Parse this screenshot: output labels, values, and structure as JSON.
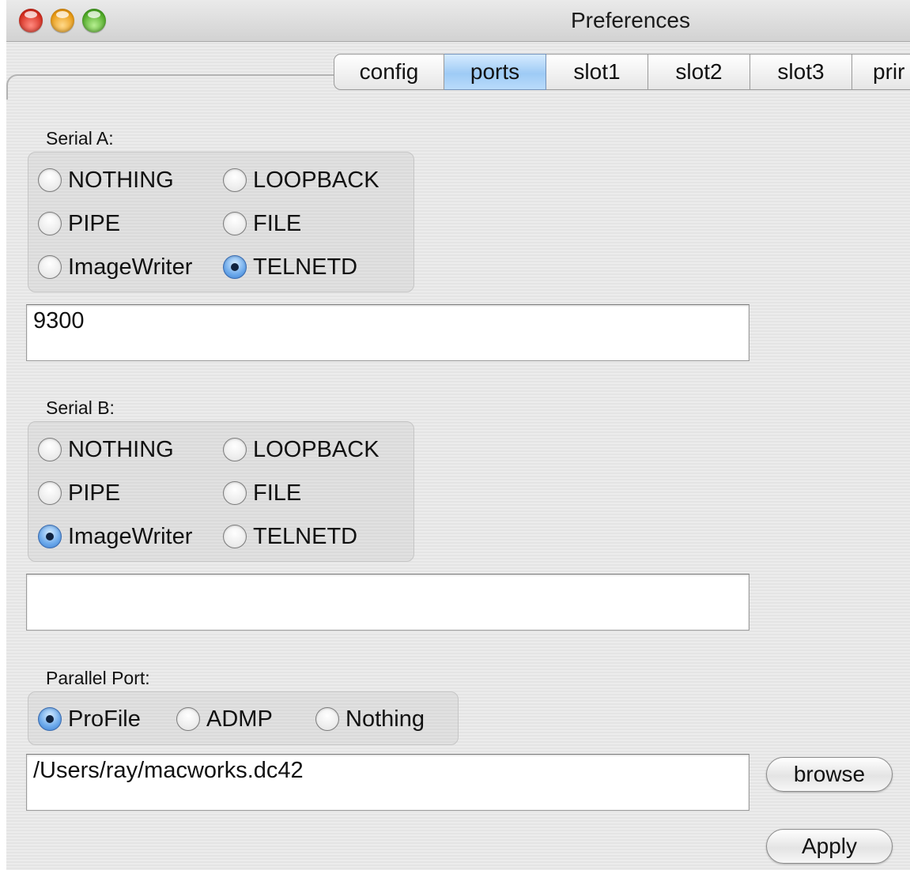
{
  "window": {
    "title": "Preferences"
  },
  "tabs": [
    {
      "label": "config"
    },
    {
      "label": "ports",
      "active": true
    },
    {
      "label": "slot1"
    },
    {
      "label": "slot2"
    },
    {
      "label": "slot3"
    },
    {
      "label": "prir"
    }
  ],
  "serial_a": {
    "label": "Serial A:",
    "options": [
      "NOTHING",
      "LOOPBACK",
      "PIPE",
      "FILE",
      "ImageWriter",
      "TELNETD"
    ],
    "selected": "TELNETD",
    "value": "9300"
  },
  "serial_b": {
    "label": "Serial B:",
    "options": [
      "NOTHING",
      "LOOPBACK",
      "PIPE",
      "FILE",
      "ImageWriter",
      "TELNETD"
    ],
    "selected": "ImageWriter",
    "value": ""
  },
  "parallel": {
    "label": "Parallel Port:",
    "options": [
      "ProFile",
      "ADMP",
      "Nothing"
    ],
    "selected": "ProFile",
    "value": "/Users/ray/macworks.dc42"
  },
  "buttons": {
    "browse": "browse",
    "apply": "Apply"
  },
  "colors": {
    "accent": "#6aa8eb",
    "close": "#d52d1f",
    "minimize": "#e99a13",
    "zoom": "#4faa26"
  }
}
